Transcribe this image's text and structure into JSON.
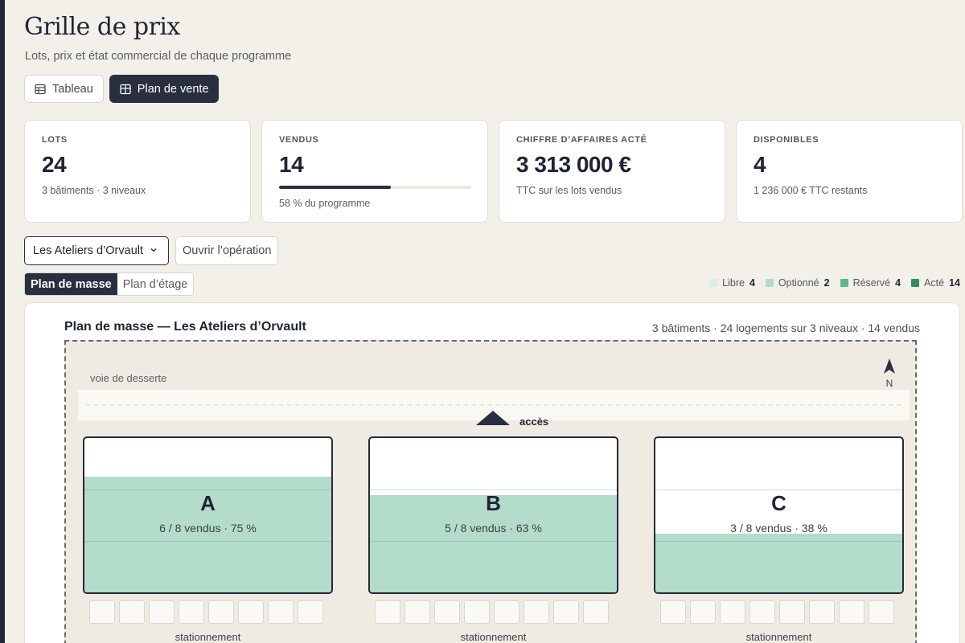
{
  "header": {
    "title": "Grille de prix",
    "subtitle": "Lots, prix et état commercial de chaque programme"
  },
  "view_toggle": {
    "tableau": "Tableau",
    "plan_vente": "Plan de vente",
    "active": "plan_vente"
  },
  "kpis": {
    "lots": {
      "label": "LOTS",
      "value": "24",
      "note": "3 bâtiments · 3 niveaux"
    },
    "vendus": {
      "label": "VENDUS",
      "value": "14",
      "progress": 0.58,
      "note": "58 % du programme"
    },
    "ca": {
      "label": "CHIFFRE D’AFFAIRES ACTÉ",
      "value": "3 313 000 €",
      "note": "TTC sur les lots vendus"
    },
    "dispo": {
      "label": "DISPONIBLES",
      "value": "4",
      "note": "1 236 000 € TTC restants"
    }
  },
  "operation": {
    "selected": "Les Ateliers d’Orvault",
    "open_label": "Ouvrir l’opération"
  },
  "plan_tabs": {
    "masse": "Plan de masse",
    "etage": "Plan d’étage",
    "active": "masse"
  },
  "legend": [
    {
      "label": "Libre",
      "count": "4",
      "color": "#dcefe6"
    },
    {
      "label": "Optionné",
      "count": "2",
      "color": "#b3dccb"
    },
    {
      "label": "Réservé",
      "count": "4",
      "color": "#5bb892"
    },
    {
      "label": "Acté",
      "count": "14",
      "color": "#2e8f62"
    }
  ],
  "plan": {
    "title": "Plan de masse — Les Ateliers d’Orvault",
    "summary": "3 bâtiments · 24 logements sur 3 niveaux · 14 vendus",
    "road_label": "voie de desserte",
    "north": "N",
    "access": "accès",
    "buildings": [
      {
        "letter": "A",
        "stat": "6 / 8 vendus · 75 %",
        "sold_fraction": 0.75,
        "parking_label": "stationnement"
      },
      {
        "letter": "B",
        "stat": "5 / 8 vendus · 63 %",
        "sold_fraction": 0.63,
        "parking_label": "stationnement"
      },
      {
        "letter": "C",
        "stat": "3 / 8 vendus · 38 %",
        "sold_fraction": 0.38,
        "parking_label": "stationnement"
      }
    ]
  },
  "colors": {
    "navy": "#2a2f40",
    "sold_fill": "#b3dccb",
    "background": "#f3f0ea"
  }
}
